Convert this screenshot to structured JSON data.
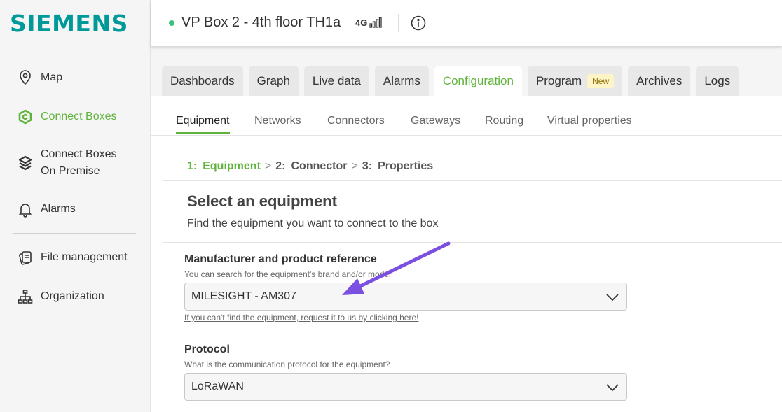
{
  "brand": {
    "logo": "SIEMENS",
    "color": "#009999",
    "accent": "#5fb33a"
  },
  "sidebar": {
    "items": [
      {
        "label": "Map",
        "icon": "map-pin-icon"
      },
      {
        "label": "Connect Boxes",
        "icon": "connect-box-icon",
        "active": true
      },
      {
        "label_line1": "Connect Boxes",
        "label_line2": "On Premise",
        "icon": "connect-box-premise-icon"
      },
      {
        "label": "Alarms",
        "icon": "bell-icon"
      },
      {
        "label": "File management",
        "icon": "files-icon"
      },
      {
        "label": "Organization",
        "icon": "org-chart-icon"
      }
    ]
  },
  "header": {
    "title": "VP Box 2 - 4th floor TH1a",
    "network": "4G",
    "status_color": "#36c47a"
  },
  "tabs": [
    {
      "label": "Dashboards"
    },
    {
      "label": "Graph"
    },
    {
      "label": "Live data"
    },
    {
      "label": "Alarms"
    },
    {
      "label": "Configuration",
      "active": true
    },
    {
      "label": "Program",
      "badge": "New"
    },
    {
      "label": "Archives"
    },
    {
      "label": "Logs"
    }
  ],
  "subtabs": [
    {
      "label": "Equipment",
      "active": true
    },
    {
      "label": "Networks"
    },
    {
      "label": "Connectors"
    },
    {
      "label": "Gateways"
    },
    {
      "label": "Routing"
    },
    {
      "label": "Virtual properties"
    }
  ],
  "steps": [
    {
      "num": "1:",
      "label": "Equipment",
      "active": true
    },
    {
      "num": "2:",
      "label": "Connector"
    },
    {
      "num": "3:",
      "label": "Properties"
    }
  ],
  "step_separator": ">",
  "section": {
    "title": "Select an equipment",
    "subtitle": "Find the equipment you want to connect to the box"
  },
  "manufacturer": {
    "label": "Manufacturer and product reference",
    "help": "You can search for the equipment's brand and/or model",
    "value": "MILESIGHT - AM307",
    "link": "If you can't find the equipment, request it to us by clicking here!"
  },
  "protocol": {
    "label": "Protocol",
    "help": "What is the communication protocol for the equipment?",
    "value": "LoRaWAN"
  },
  "annotation_arrow_color": "#7b4fe0"
}
